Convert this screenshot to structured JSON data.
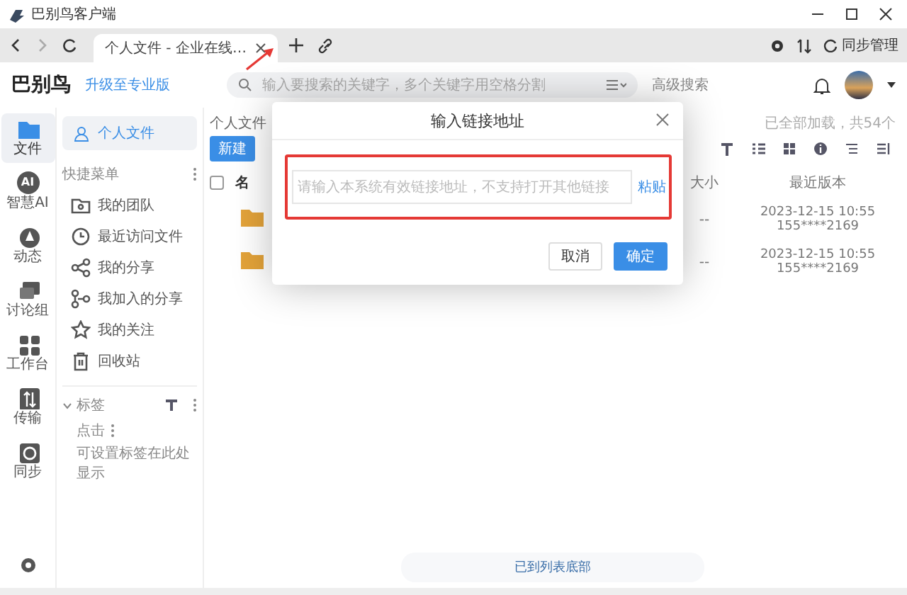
{
  "window": {
    "title": "巴别鸟客户端"
  },
  "tabs": [
    {
      "label": "个人文件 - 企业在线…",
      "selected": true
    }
  ],
  "tab_bar": {
    "sync_label": "同步管理"
  },
  "header": {
    "logo": "巴别鸟",
    "upgrade_link": "升级至专业版",
    "search": {
      "placeholder": "输入要搜索的关键字，多个关键字用空格分割"
    },
    "advanced_search": "高级搜索"
  },
  "rail": [
    {
      "label": "文件",
      "kind": "folder",
      "selected": true
    },
    {
      "label": "智慧AI",
      "kind": "ai",
      "icon_text": "AI",
      "selected": false
    },
    {
      "label": "动态",
      "kind": "activity",
      "selected": false
    },
    {
      "label": "讨论组",
      "kind": "chat",
      "selected": false
    },
    {
      "label": "工作台",
      "kind": "workbench",
      "selected": false
    },
    {
      "label": "传输",
      "kind": "transfer",
      "selected": false
    },
    {
      "label": "同步",
      "kind": "sync",
      "selected": false
    }
  ],
  "sidebar": {
    "top_item": {
      "label": "个人文件",
      "selected": true
    },
    "quick_menu_title": "快捷菜单",
    "quick_items": [
      {
        "label": "我的团队",
        "kind": "team"
      },
      {
        "label": "最近访问文件",
        "kind": "recent"
      },
      {
        "label": "我的分享",
        "kind": "share"
      },
      {
        "label": "我加入的分享",
        "kind": "joined"
      },
      {
        "label": "我的关注",
        "kind": "star"
      },
      {
        "label": "回收站",
        "kind": "trash"
      }
    ],
    "tags": {
      "title": "标签",
      "expanded": true,
      "hint_before": "点击",
      "hint_after": "可设置标签在此处显示"
    }
  },
  "file_pane": {
    "breadcrumb": "个人文件",
    "new_button": "新建",
    "select_all": {
      "checked": false
    },
    "load_status": "已全部加载，共54个",
    "columns": [
      {
        "label": "名"
      },
      {
        "label": "大小"
      },
      {
        "label": "最近版本"
      }
    ],
    "rows": [
      {
        "size": "--",
        "version_time": "2023-12-15 10:55",
        "version_user": "155****2169"
      },
      {
        "size": "--",
        "version_time": "2023-12-15 10:55",
        "version_user": "155****2169"
      }
    ],
    "list_end": "已到列表底部"
  },
  "dialog": {
    "title": "输入链接地址",
    "link_field": {
      "placeholder": "请输入本系统有效链接地址，不支持打开其他链接"
    },
    "paste_link": "粘贴",
    "buttons": [
      {
        "label": "取消",
        "kind": "secondary"
      },
      {
        "label": "确定",
        "kind": "primary"
      }
    ]
  }
}
